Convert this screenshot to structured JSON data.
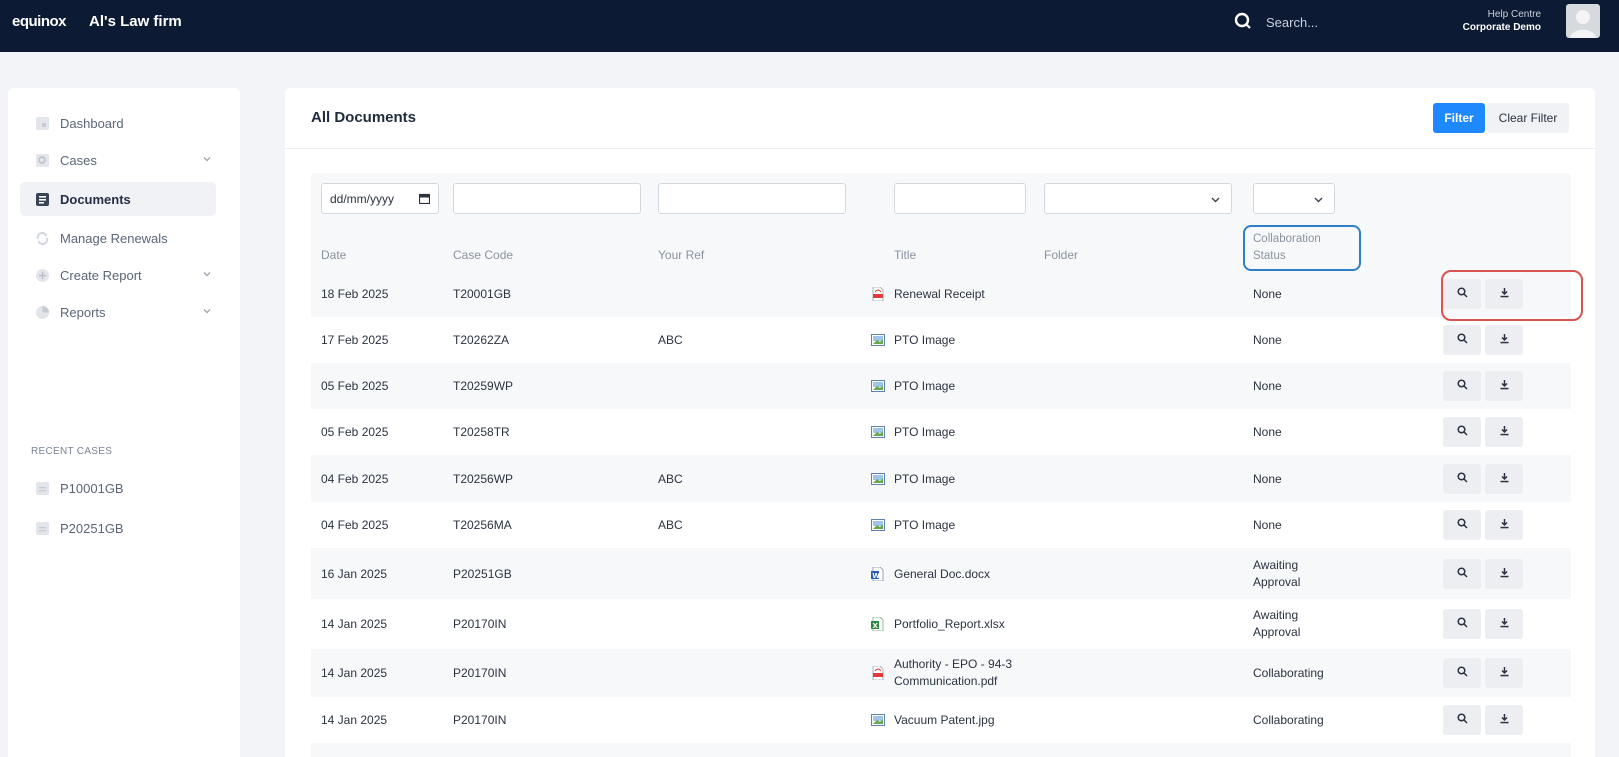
{
  "header": {
    "logo": "equinox",
    "firm_name": "Al's Law firm",
    "search_placeholder": "Search...",
    "help_link": "Help Centre",
    "user_name": "Corporate Demo"
  },
  "sidebar": {
    "items": [
      {
        "label": "Dashboard",
        "icon": "dashboard-icon"
      },
      {
        "label": "Cases",
        "icon": "cases-icon",
        "expandable": true
      },
      {
        "label": "Documents",
        "icon": "documents-icon",
        "active": true
      },
      {
        "label": "Manage Renewals",
        "icon": "renewals-icon"
      },
      {
        "label": "Create Report",
        "icon": "create-report-icon",
        "expandable": true
      },
      {
        "label": "Reports",
        "icon": "reports-icon",
        "expandable": true
      }
    ],
    "recent_label": "RECENT CASES",
    "recent_cases": [
      "P10001GB",
      "P20251GB"
    ]
  },
  "main": {
    "title": "All Documents",
    "filter_button": "Filter",
    "clear_filter_button": "Clear Filter",
    "date_placeholder": "dd/mm/yyyy",
    "columns": {
      "date": "Date",
      "case_code": "Case Code",
      "your_ref": "Your Ref",
      "title": "Title",
      "folder": "Folder",
      "collab_line1": "Collaboration",
      "collab_line2": "Status"
    },
    "rows": [
      {
        "date": "18 Feb 2025",
        "case_code": "T20001GB",
        "your_ref": "",
        "file_type": "pdf",
        "title": "Renewal Receipt",
        "title2": "",
        "folder": "",
        "status": "None",
        "status2": ""
      },
      {
        "date": "17 Feb 2025",
        "case_code": "T20262ZA",
        "your_ref": "ABC",
        "file_type": "image",
        "title": "PTO Image",
        "title2": "",
        "folder": "",
        "status": "None",
        "status2": ""
      },
      {
        "date": "05 Feb 2025",
        "case_code": "T20259WP",
        "your_ref": "",
        "file_type": "image",
        "title": "PTO Image",
        "title2": "",
        "folder": "",
        "status": "None",
        "status2": ""
      },
      {
        "date": "05 Feb 2025",
        "case_code": "T20258TR",
        "your_ref": "",
        "file_type": "image",
        "title": "PTO Image",
        "title2": "",
        "folder": "",
        "status": "None",
        "status2": ""
      },
      {
        "date": "04 Feb 2025",
        "case_code": "T20256WP",
        "your_ref": "ABC",
        "file_type": "image",
        "title": "PTO Image",
        "title2": "",
        "folder": "",
        "status": "None",
        "status2": ""
      },
      {
        "date": "04 Feb 2025",
        "case_code": "T20256MA",
        "your_ref": "ABC",
        "file_type": "image",
        "title": "PTO Image",
        "title2": "",
        "folder": "",
        "status": "None",
        "status2": ""
      },
      {
        "date": "16 Jan 2025",
        "case_code": "P20251GB",
        "your_ref": "",
        "file_type": "word",
        "title": "General Doc.docx",
        "title2": "",
        "folder": "",
        "status": "Awaiting",
        "status2": "Approval"
      },
      {
        "date": "14 Jan 2025",
        "case_code": "P20170IN",
        "your_ref": "",
        "file_type": "excel",
        "title": "Portfolio_Report.xlsx",
        "title2": "",
        "folder": "",
        "status": "Awaiting",
        "status2": "Approval"
      },
      {
        "date": "14 Jan 2025",
        "case_code": "P20170IN",
        "your_ref": "",
        "file_type": "pdf",
        "title": "Authority - EPO - 94-3",
        "title2": "Communication.pdf",
        "folder": "",
        "status": "Collaborating",
        "status2": ""
      },
      {
        "date": "14 Jan 2025",
        "case_code": "P20170IN",
        "your_ref": "",
        "file_type": "image",
        "title": "Vacuum Patent.jpg",
        "title2": "",
        "folder": "",
        "status": "Collaborating",
        "status2": ""
      }
    ]
  },
  "colors": {
    "topbar": "#0c1a33",
    "accent": "#1e88ff",
    "highlight_blue": "#2f7fc8",
    "highlight_red": "#d9534f"
  }
}
